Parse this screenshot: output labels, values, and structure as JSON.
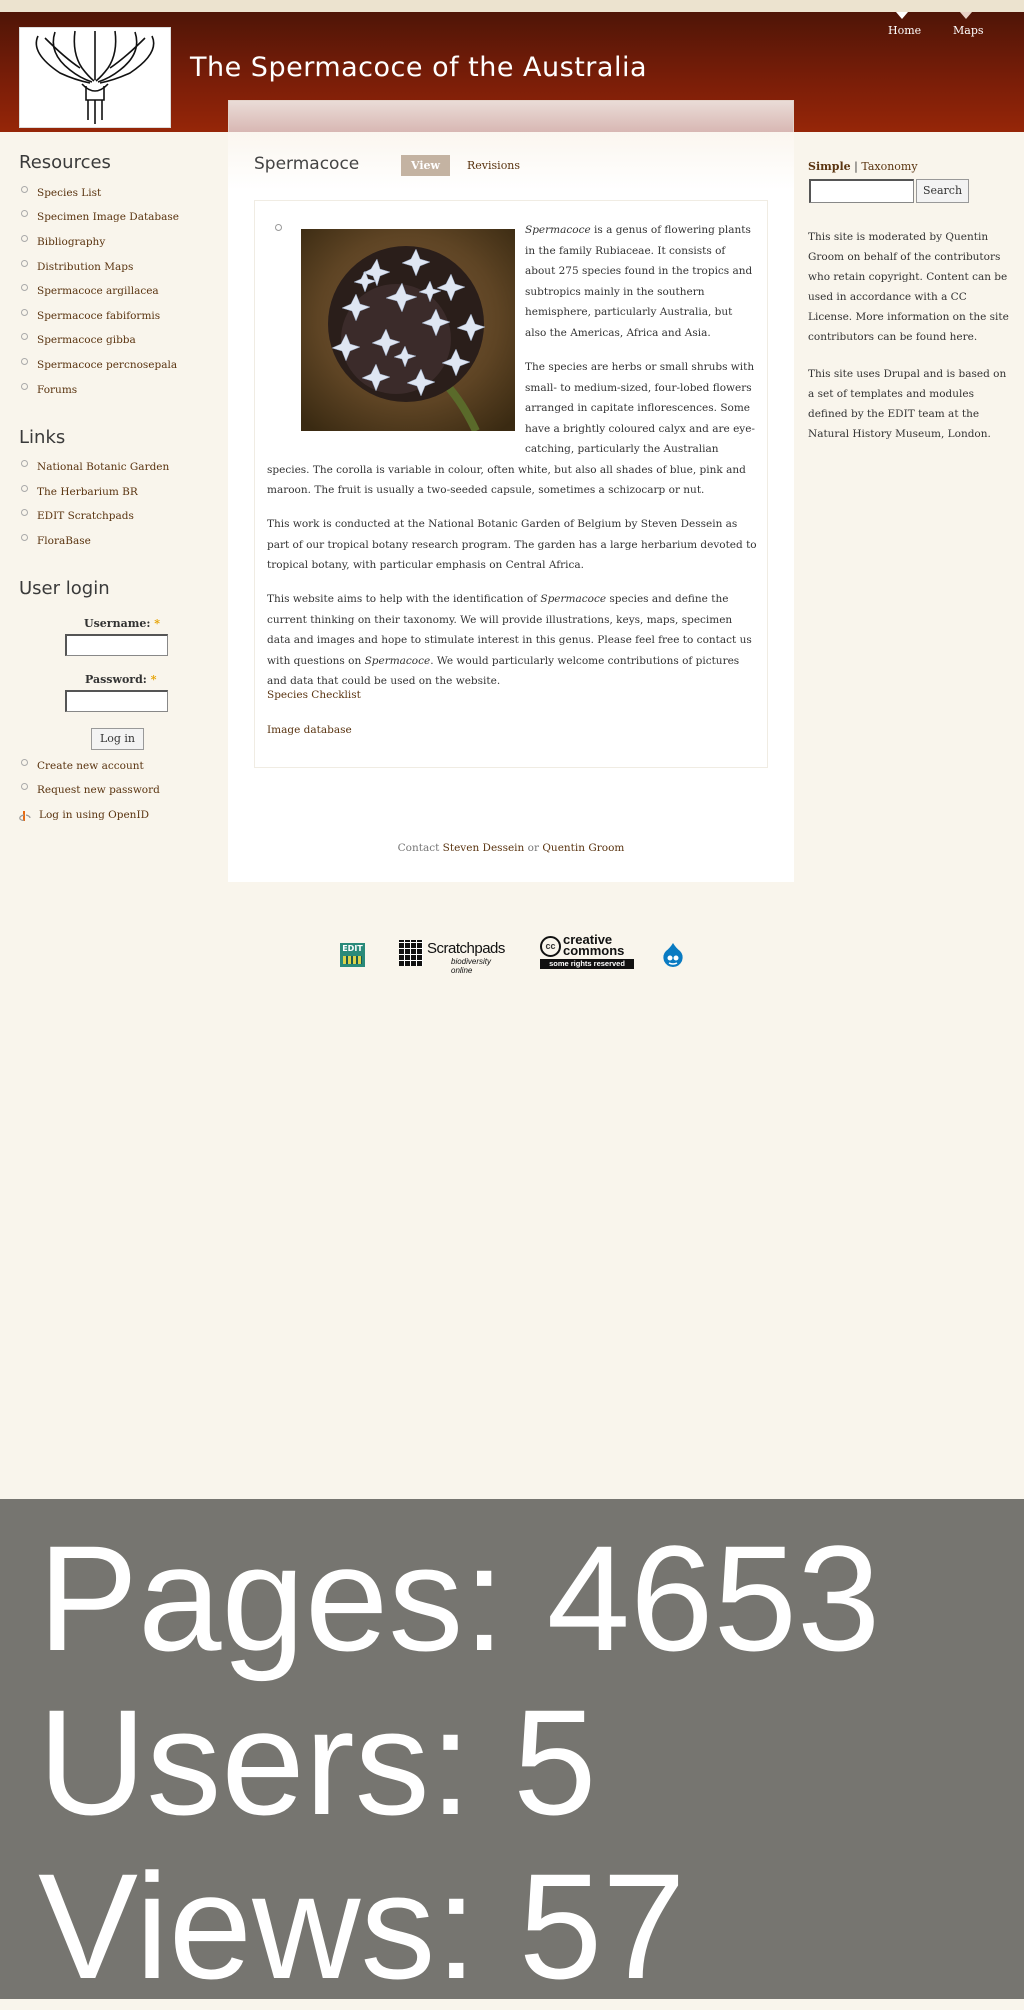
{
  "header": {
    "site_title": "The Spermacoce of the Australia",
    "nav": [
      "Home",
      "Maps"
    ]
  },
  "sidebar": {
    "resources_title": "Resources",
    "resources": [
      "Species List",
      "Specimen Image Database",
      "Bibliography",
      "Distribution Maps",
      "Spermacoce argillacea",
      "Spermacoce fabiformis",
      "Spermacoce gibba",
      "Spermacoce percnosepala",
      "Forums"
    ],
    "links_title": "Links",
    "links": [
      "National Botanic Garden",
      "The Herbarium BR",
      "EDIT Scratchpads",
      "FloraBase"
    ],
    "login_title": "User login",
    "username_label": "Username:",
    "password_label": "Password:",
    "required_mark": "*",
    "login_button": "Log in",
    "account_links": [
      "Create new account",
      "Request new password",
      "Log in using OpenID"
    ]
  },
  "main": {
    "title": "Spermacoce",
    "tabs": [
      "View",
      "Revisions"
    ],
    "para1_em": "Spermacoce",
    "para1_rest": " is a genus of flowering plants in the family Rubiaceae. It consists of about 275 species found in the tropics and subtropics mainly in the southern hemisphere, particularly Australia, but also the Americas, Africa and Asia.",
    "para2": "The species are herbs or small shrubs with small- to medium-sized, four-lobed flowers arranged in capitate inflorescences. Some have a brightly coloured calyx and are eye-catching, particularly the Australian species. The corolla is variable in colour, often white, but also all shades of blue, pink and maroon. The fruit is usually a two-seeded capsule, sometimes a schizocarp or nut.",
    "para3": "This work is conducted at the National Botanic Garden of Belgium by Steven Dessein as part of our tropical botany research program. The garden has a large herbarium devoted to tropical botany, with particular emphasis on Central Africa.",
    "para4_a": "This website aims to help with the identification of ",
    "para4_em1": "Spermacoce",
    "para4_b": " species and define the current thinking on their taxonomy. We will provide illustrations, keys, maps, specimen data and images and hope to stimulate interest in this genus. Please feel free to contact us with questions on ",
    "para4_em2": "Spermacoce",
    "para4_c": ". We would particularly welcome contributions of pictures and data that could be used on the website.",
    "link1": "Species Checklist",
    "link2": "Image database",
    "contact_prefix": "Contact ",
    "contact_name1": "Steven Dessein",
    "contact_or": " or ",
    "contact_name2": "Quentin Groom"
  },
  "right": {
    "search_tab_active": "Simple",
    "search_sep": " | ",
    "search_tab_other": "Taxonomy",
    "search_button": "Search",
    "text1": "This site is moderated by Quentin Groom on behalf of the contributors who retain copyright. Content can be used in accordance with a CC License. More information on the site contributors can be found here.",
    "text2": "This site uses Drupal and is based on a set of templates and modules defined by the EDIT team at the Natural History Museum, London."
  },
  "footer": {
    "edit_logo": "EDIT",
    "scratchpads_logo": "Scratchpads",
    "scratchpads_sub": "biodiversity online",
    "cc_logo": "creative commons",
    "cc_sub": "some rights reserved"
  },
  "stats": {
    "pages": "Pages: 4653",
    "users": "Users: 5",
    "views": "Views: 57"
  }
}
